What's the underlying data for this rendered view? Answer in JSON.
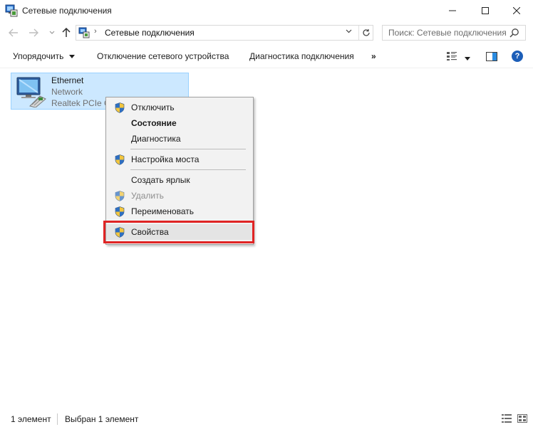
{
  "window": {
    "title": "Сетевые подключения",
    "minimize_icon": "minimize-icon",
    "maximize_icon": "maximize-icon",
    "close_icon": "close-icon"
  },
  "address_bar": {
    "path_separator": "›",
    "path": "Сетевые подключения",
    "search_placeholder": "Поиск: Сетевые подключения"
  },
  "command_bar": {
    "organize": "Упорядочить",
    "disable_device": "Отключение сетевого устройства",
    "diagnose": "Диагностика подключения",
    "more": "»",
    "help": "?"
  },
  "item": {
    "name": "Ethernet",
    "network": "Network",
    "adapter": "Realtek PCIe GbE Family Controller"
  },
  "context_menu": {
    "items": [
      {
        "label": "Отключить",
        "shield": true,
        "bold": false,
        "disabled": false
      },
      {
        "label": "Состояние",
        "shield": false,
        "bold": true,
        "disabled": false
      },
      {
        "label": "Диагностика",
        "shield": false,
        "bold": false,
        "disabled": false
      },
      {
        "label": "Настройка моста",
        "shield": true,
        "bold": false,
        "disabled": false
      },
      {
        "label": "Создать ярлык",
        "shield": false,
        "bold": false,
        "disabled": false
      },
      {
        "label": "Удалить",
        "shield": true,
        "bold": false,
        "disabled": true
      },
      {
        "label": "Переименовать",
        "shield": true,
        "bold": false,
        "disabled": false
      },
      {
        "label": "Свойства",
        "shield": true,
        "bold": false,
        "disabled": false
      }
    ]
  },
  "status_bar": {
    "count": "1 элемент",
    "selected": "Выбран 1 элемент"
  },
  "colors": {
    "selection_bg": "#cce8ff",
    "highlight_border": "#e02424",
    "help_blue": "#1c5eb8"
  }
}
